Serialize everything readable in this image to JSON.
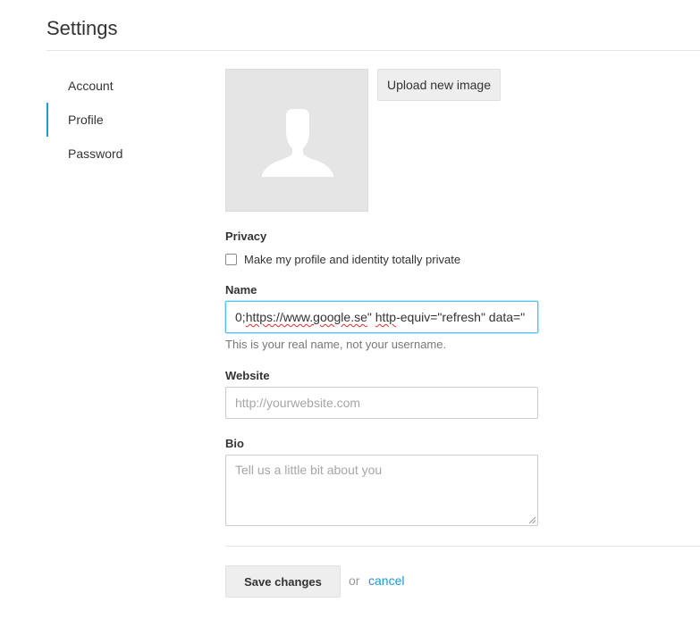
{
  "page": {
    "title": "Settings"
  },
  "sidebar": {
    "items": [
      {
        "label": "Account",
        "active": false
      },
      {
        "label": "Profile",
        "active": true
      },
      {
        "label": "Password",
        "active": false
      }
    ],
    "accent_color": "#1a9bd7"
  },
  "avatar": {
    "icon": "user-silhouette-icon",
    "upload_label": "Upload new image"
  },
  "privacy": {
    "label": "Privacy",
    "checkbox_label": "Make my profile and identity totally private",
    "checked": false
  },
  "name": {
    "label": "Name",
    "value_prefix": "0;",
    "value_url": "https://www.google.se",
    "value_middle": "\" ",
    "value_attr": "http",
    "value_suffix": "-equiv=\"refresh\" data=\"",
    "helper": "This is your real name, not your username."
  },
  "website": {
    "label": "Website",
    "placeholder": "http://yourwebsite.com",
    "value": ""
  },
  "bio": {
    "label": "Bio",
    "placeholder": "Tell us a little bit about you",
    "value": ""
  },
  "actions": {
    "save_label": "Save changes",
    "or_label": "or",
    "cancel_label": "cancel"
  }
}
